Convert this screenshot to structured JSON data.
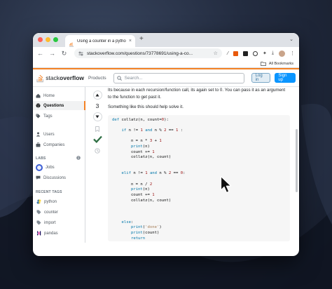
{
  "tab": {
    "title": "Using a counter in a python f",
    "close": "×"
  },
  "new_tab": "+",
  "tab_menu": "⌄",
  "toolbar": {
    "back": "←",
    "forward": "→",
    "reload": "↻",
    "url": "stackoverflow.com/questions/73778691/using-a-co...",
    "bookmark_star": "☆"
  },
  "bookmarks": {
    "label": "All Bookmarks"
  },
  "header": {
    "logo_light": "stack",
    "logo_bold": "overflow",
    "products": "Products",
    "search_placeholder": "Search...",
    "login": "Log in",
    "signup": "Sign up"
  },
  "sidebar": {
    "items": [
      {
        "label": "Home"
      },
      {
        "label": "Questions"
      },
      {
        "label": "Tags"
      },
      {
        "label": "Users"
      },
      {
        "label": "Companies"
      }
    ],
    "labs_title": "LABS",
    "labs": [
      {
        "label": "Jobs"
      },
      {
        "label": "Discussions"
      }
    ],
    "recent_title": "RECENT TAGS",
    "recent": [
      {
        "label": "python"
      },
      {
        "label": "counter"
      },
      {
        "label": "import"
      },
      {
        "label": "pandas"
      }
    ]
  },
  "votes": {
    "count": "3"
  },
  "answer": {
    "para1": "Its because in each recursion/function call, its again set to 0. You can pass it as an argument to the function to get past it.",
    "para2": "Something like this should help solve it."
  },
  "colors": {
    "so_orange": "#f48225",
    "so_blue": "#0a95ff",
    "accepted_green": "#2f6f44"
  }
}
